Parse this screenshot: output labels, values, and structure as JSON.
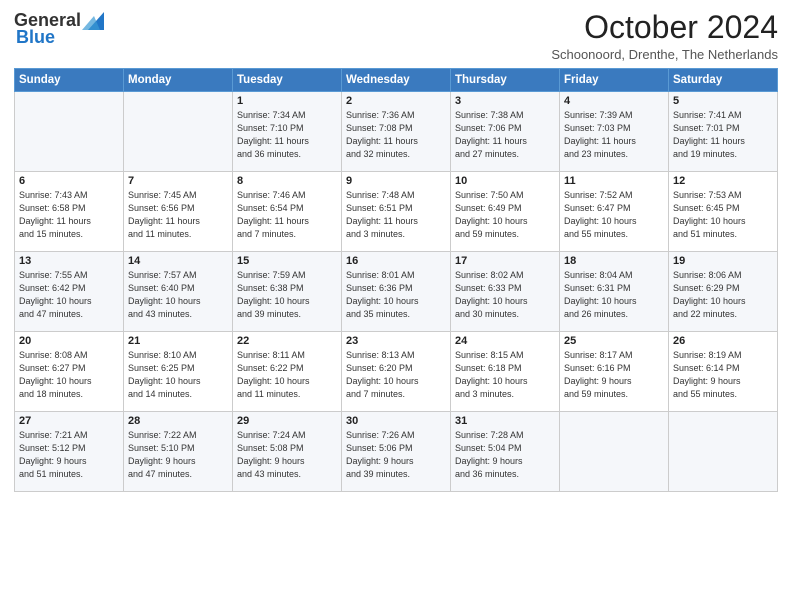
{
  "header": {
    "logo_general": "General",
    "logo_blue": "Blue",
    "month": "October 2024",
    "location": "Schoonoord, Drenthe, The Netherlands"
  },
  "weekdays": [
    "Sunday",
    "Monday",
    "Tuesday",
    "Wednesday",
    "Thursday",
    "Friday",
    "Saturday"
  ],
  "weeks": [
    [
      {
        "day": "",
        "info": ""
      },
      {
        "day": "",
        "info": ""
      },
      {
        "day": "1",
        "info": "Sunrise: 7:34 AM\nSunset: 7:10 PM\nDaylight: 11 hours\nand 36 minutes."
      },
      {
        "day": "2",
        "info": "Sunrise: 7:36 AM\nSunset: 7:08 PM\nDaylight: 11 hours\nand 32 minutes."
      },
      {
        "day": "3",
        "info": "Sunrise: 7:38 AM\nSunset: 7:06 PM\nDaylight: 11 hours\nand 27 minutes."
      },
      {
        "day": "4",
        "info": "Sunrise: 7:39 AM\nSunset: 7:03 PM\nDaylight: 11 hours\nand 23 minutes."
      },
      {
        "day": "5",
        "info": "Sunrise: 7:41 AM\nSunset: 7:01 PM\nDaylight: 11 hours\nand 19 minutes."
      }
    ],
    [
      {
        "day": "6",
        "info": "Sunrise: 7:43 AM\nSunset: 6:58 PM\nDaylight: 11 hours\nand 15 minutes."
      },
      {
        "day": "7",
        "info": "Sunrise: 7:45 AM\nSunset: 6:56 PM\nDaylight: 11 hours\nand 11 minutes."
      },
      {
        "day": "8",
        "info": "Sunrise: 7:46 AM\nSunset: 6:54 PM\nDaylight: 11 hours\nand 7 minutes."
      },
      {
        "day": "9",
        "info": "Sunrise: 7:48 AM\nSunset: 6:51 PM\nDaylight: 11 hours\nand 3 minutes."
      },
      {
        "day": "10",
        "info": "Sunrise: 7:50 AM\nSunset: 6:49 PM\nDaylight: 10 hours\nand 59 minutes."
      },
      {
        "day": "11",
        "info": "Sunrise: 7:52 AM\nSunset: 6:47 PM\nDaylight: 10 hours\nand 55 minutes."
      },
      {
        "day": "12",
        "info": "Sunrise: 7:53 AM\nSunset: 6:45 PM\nDaylight: 10 hours\nand 51 minutes."
      }
    ],
    [
      {
        "day": "13",
        "info": "Sunrise: 7:55 AM\nSunset: 6:42 PM\nDaylight: 10 hours\nand 47 minutes."
      },
      {
        "day": "14",
        "info": "Sunrise: 7:57 AM\nSunset: 6:40 PM\nDaylight: 10 hours\nand 43 minutes."
      },
      {
        "day": "15",
        "info": "Sunrise: 7:59 AM\nSunset: 6:38 PM\nDaylight: 10 hours\nand 39 minutes."
      },
      {
        "day": "16",
        "info": "Sunrise: 8:01 AM\nSunset: 6:36 PM\nDaylight: 10 hours\nand 35 minutes."
      },
      {
        "day": "17",
        "info": "Sunrise: 8:02 AM\nSunset: 6:33 PM\nDaylight: 10 hours\nand 30 minutes."
      },
      {
        "day": "18",
        "info": "Sunrise: 8:04 AM\nSunset: 6:31 PM\nDaylight: 10 hours\nand 26 minutes."
      },
      {
        "day": "19",
        "info": "Sunrise: 8:06 AM\nSunset: 6:29 PM\nDaylight: 10 hours\nand 22 minutes."
      }
    ],
    [
      {
        "day": "20",
        "info": "Sunrise: 8:08 AM\nSunset: 6:27 PM\nDaylight: 10 hours\nand 18 minutes."
      },
      {
        "day": "21",
        "info": "Sunrise: 8:10 AM\nSunset: 6:25 PM\nDaylight: 10 hours\nand 14 minutes."
      },
      {
        "day": "22",
        "info": "Sunrise: 8:11 AM\nSunset: 6:22 PM\nDaylight: 10 hours\nand 11 minutes."
      },
      {
        "day": "23",
        "info": "Sunrise: 8:13 AM\nSunset: 6:20 PM\nDaylight: 10 hours\nand 7 minutes."
      },
      {
        "day": "24",
        "info": "Sunrise: 8:15 AM\nSunset: 6:18 PM\nDaylight: 10 hours\nand 3 minutes."
      },
      {
        "day": "25",
        "info": "Sunrise: 8:17 AM\nSunset: 6:16 PM\nDaylight: 9 hours\nand 59 minutes."
      },
      {
        "day": "26",
        "info": "Sunrise: 8:19 AM\nSunset: 6:14 PM\nDaylight: 9 hours\nand 55 minutes."
      }
    ],
    [
      {
        "day": "27",
        "info": "Sunrise: 7:21 AM\nSunset: 5:12 PM\nDaylight: 9 hours\nand 51 minutes."
      },
      {
        "day": "28",
        "info": "Sunrise: 7:22 AM\nSunset: 5:10 PM\nDaylight: 9 hours\nand 47 minutes."
      },
      {
        "day": "29",
        "info": "Sunrise: 7:24 AM\nSunset: 5:08 PM\nDaylight: 9 hours\nand 43 minutes."
      },
      {
        "day": "30",
        "info": "Sunrise: 7:26 AM\nSunset: 5:06 PM\nDaylight: 9 hours\nand 39 minutes."
      },
      {
        "day": "31",
        "info": "Sunrise: 7:28 AM\nSunset: 5:04 PM\nDaylight: 9 hours\nand 36 minutes."
      },
      {
        "day": "",
        "info": ""
      },
      {
        "day": "",
        "info": ""
      }
    ]
  ]
}
